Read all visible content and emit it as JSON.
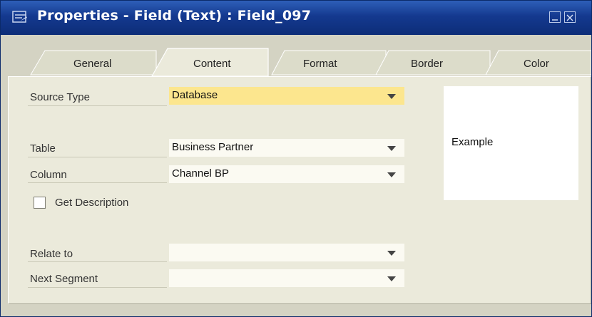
{
  "window": {
    "title": "Properties - Field (Text) : Field_097",
    "icons": {
      "app": "form-icon",
      "minimize": "minimize-icon",
      "close": "close-icon"
    }
  },
  "tabs": [
    {
      "label": "General"
    },
    {
      "label": "Content",
      "selected": true
    },
    {
      "label": "Format"
    },
    {
      "label": "Border"
    },
    {
      "label": "Color"
    }
  ],
  "form": {
    "source_type": {
      "label": "Source Type",
      "value": "Database"
    },
    "table": {
      "label": "Table",
      "value": "Business Partner"
    },
    "column": {
      "label": "Column",
      "value": "Channel BP"
    },
    "get_description": {
      "label": "Get Description",
      "checked": false
    },
    "relate_to": {
      "label": "Relate to",
      "value": ""
    },
    "next_segment": {
      "label": "Next Segment",
      "value": ""
    }
  },
  "preview": {
    "text": "Example"
  },
  "colors": {
    "titlebar": "#14398f",
    "highlight": "#fce68e",
    "panel": "#ebeadb"
  }
}
